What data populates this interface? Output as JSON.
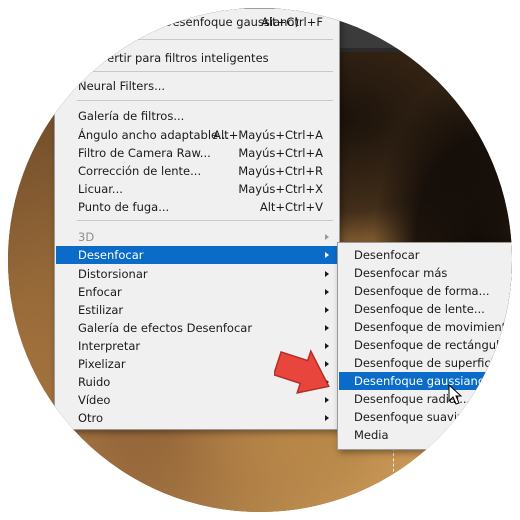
{
  "menu": {
    "items": [
      {
        "label": "Filtro anterior  (Desenfoque gaussiano)",
        "shortcut": "Alt+Ctrl+F",
        "disabled": false
      },
      {
        "label": "Convertir para filtros inteligentes",
        "shortcut": ""
      },
      {
        "label": "Neural Filters...",
        "shortcut": ""
      },
      {
        "label": "Galería de filtros...",
        "shortcut": ""
      },
      {
        "label": "Ángulo ancho adaptable...",
        "shortcut": "Alt+Mayús+Ctrl+A"
      },
      {
        "label": "Filtro de Camera Raw...",
        "shortcut": "Mayús+Ctrl+A"
      },
      {
        "label": "Corrección de lente...",
        "shortcut": "Mayús+Ctrl+R"
      },
      {
        "label": "Licuar...",
        "shortcut": "Mayús+Ctrl+X"
      },
      {
        "label": "Punto de fuga...",
        "shortcut": "Alt+Ctrl+V"
      },
      {
        "label": "3D",
        "shortcut": "",
        "disabled": true
      },
      {
        "label": "Desenfocar",
        "shortcut": ""
      },
      {
        "label": "Distorsionar",
        "shortcut": ""
      },
      {
        "label": "Enfocar",
        "shortcut": ""
      },
      {
        "label": "Estilizar",
        "shortcut": ""
      },
      {
        "label": "Galería de efectos Desenfocar",
        "shortcut": ""
      },
      {
        "label": "Interpretar",
        "shortcut": ""
      },
      {
        "label": "Pixelizar",
        "shortcut": ""
      },
      {
        "label": "Ruido",
        "shortcut": ""
      },
      {
        "label": "Vídeo",
        "shortcut": ""
      },
      {
        "label": "Otro",
        "shortcut": ""
      }
    ]
  },
  "submenu": {
    "items": [
      "Desenfocar",
      "Desenfocar más",
      "Desenfoque de forma...",
      "Desenfoque de lente...",
      "Desenfoque de movimiento...",
      "Desenfoque de rectángulo...",
      "Desenfoque de superficie...",
      "Desenfoque gaussiano...",
      "Desenfoque radial...",
      "Desenfoque suavizado...",
      "Media"
    ]
  },
  "colors": {
    "highlight": "#0a6cc8",
    "menu_bg": "#f0f0f0",
    "annotation_arrow": "#e8453c"
  }
}
